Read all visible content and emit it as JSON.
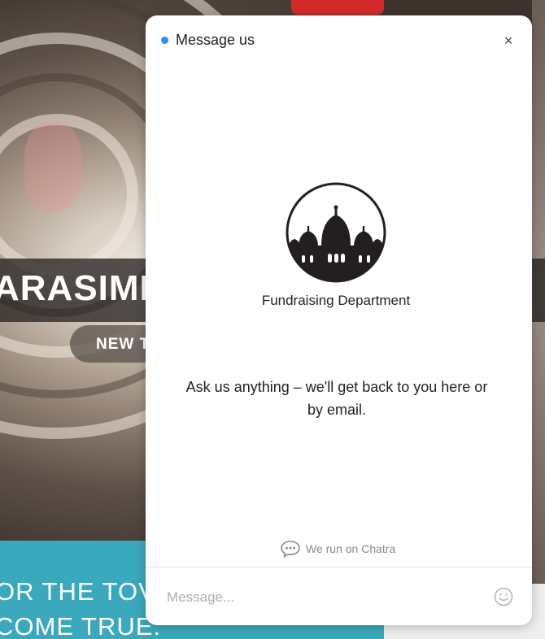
{
  "background_page": {
    "hero_title": "ARASIMHA",
    "tag_pill": "NEW T",
    "banner_line_1": "OR THE TOVP",
    "banner_line_2": "COME TRUE."
  },
  "chat_widget": {
    "header_title": "Message us",
    "status_color": "#2f8cf4",
    "close_icon": "×",
    "agent_name": "Fundraising Department",
    "welcome_message": "Ask us anything – we'll get back to you here or by email.",
    "branding_text": "We run on Chatra",
    "input_placeholder": "Message...",
    "emoji_icon": "smiley-face-icon"
  },
  "colors": {
    "teal_banner": "#3aa9bd",
    "ribbon_red": "#d62a2a"
  }
}
